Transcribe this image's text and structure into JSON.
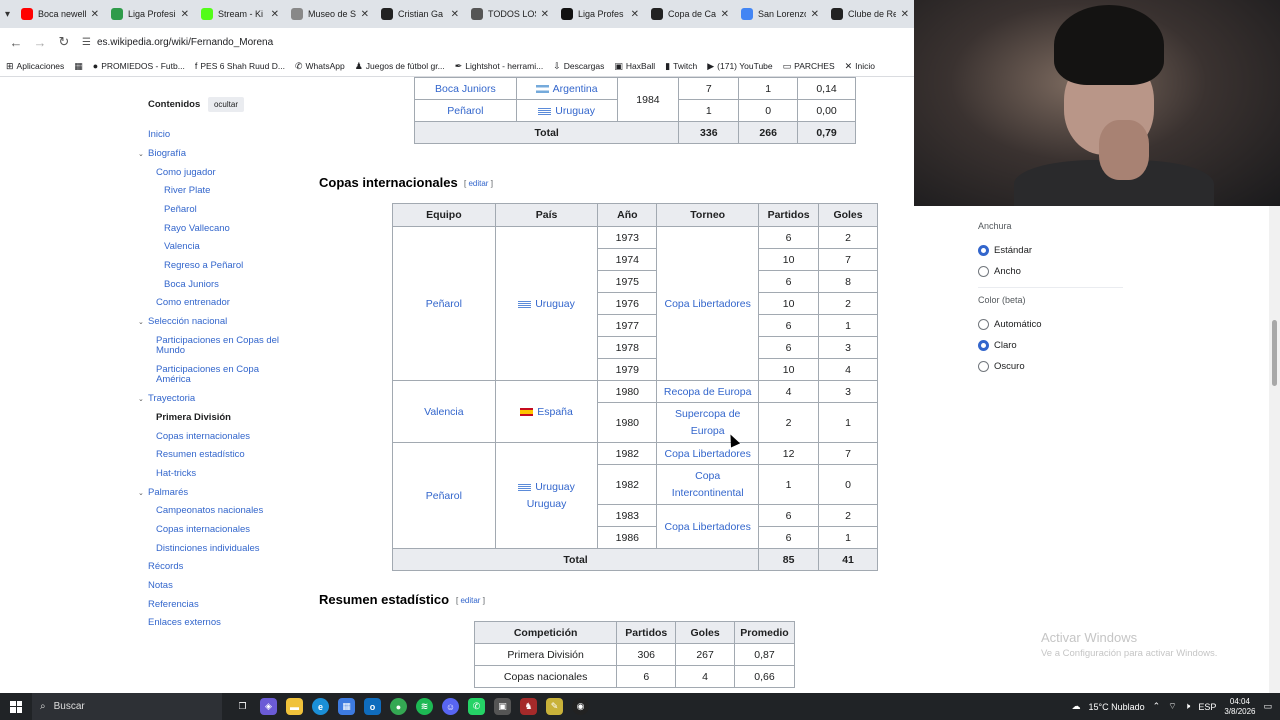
{
  "browser": {
    "tabs": [
      {
        "label": "Boca newell",
        "color": "#ff0000",
        "icon": "youtube-icon"
      },
      {
        "label": "Liga Profesi",
        "color": "#2e9b49",
        "icon": "league-icon"
      },
      {
        "label": "Stream - Ki",
        "color": "#53fc18",
        "icon": "kick-icon"
      },
      {
        "label": "Museo de S",
        "color": "#888888",
        "icon": "globe-icon"
      },
      {
        "label": "Cristian Ga",
        "color": "#222222",
        "icon": "wikipedia-icon"
      },
      {
        "label": "TODOS LOS",
        "color": "#555555",
        "icon": "globe-icon"
      },
      {
        "label": "Liga Profes",
        "color": "#111111",
        "icon": "league-icon"
      },
      {
        "label": "Copa de Ca",
        "color": "#222222",
        "icon": "wikipedia-icon"
      },
      {
        "label": "San Lorenzo",
        "color": "#4285f4",
        "icon": "google-icon"
      },
      {
        "label": "Clube de Re",
        "color": "#222222",
        "icon": "wikipedia-icon"
      }
    ],
    "url": "es.wikipedia.org/wiki/Fernando_Morena",
    "bookmarks": [
      {
        "label": "Aplicaciones",
        "icon": "apps-icon"
      },
      {
        "label": "",
        "icon": "grid-icon"
      },
      {
        "label": "PROMIEDOS - Futb...",
        "icon": "promiedos-icon"
      },
      {
        "label": "PES 6 Shah Ruud D...",
        "icon": "facebook-icon"
      },
      {
        "label": "WhatsApp",
        "icon": "whatsapp-icon"
      },
      {
        "label": "Juegos de fútbol gr...",
        "icon": "game-icon"
      },
      {
        "label": "Lightshot - herrami...",
        "icon": "lightshot-icon"
      },
      {
        "label": "Descargas",
        "icon": "download-icon"
      },
      {
        "label": "HaxBall",
        "icon": "haxball-icon"
      },
      {
        "label": "Twitch",
        "icon": "twitch-icon"
      },
      {
        "label": "(171) YouTube",
        "icon": "youtube-icon"
      },
      {
        "label": "PARCHES",
        "icon": "folder-icon"
      },
      {
        "label": "Inicio",
        "icon": "x-icon"
      }
    ]
  },
  "toc": {
    "title": "Contenidos",
    "hide": "ocultar",
    "items": [
      {
        "label": "Inicio"
      },
      {
        "label": "Biografía"
      },
      {
        "label": "Como jugador"
      },
      {
        "label": "River Plate"
      },
      {
        "label": "Peñarol"
      },
      {
        "label": "Rayo Vallecano"
      },
      {
        "label": "Valencia"
      },
      {
        "label": "Regreso a Peñarol"
      },
      {
        "label": "Boca Juniors"
      },
      {
        "label": "Como entrenador"
      },
      {
        "label": "Selección nacional"
      },
      {
        "label": "Participaciones en Copas del Mundo"
      },
      {
        "label": "Participaciones en Copa América"
      },
      {
        "label": "Trayectoria"
      },
      {
        "label": "Primera División"
      },
      {
        "label": "Copas internacionales"
      },
      {
        "label": "Resumen estadístico"
      },
      {
        "label": "Hat-tricks"
      },
      {
        "label": "Palmarés"
      },
      {
        "label": "Campeonatos nacionales"
      },
      {
        "label": "Copas internacionales"
      },
      {
        "label": "Distinciones individuales"
      },
      {
        "label": "Récords"
      },
      {
        "label": "Notas"
      },
      {
        "label": "Referencias"
      },
      {
        "label": "Enlaces externos"
      }
    ]
  },
  "top_table": {
    "rows": [
      {
        "team": "Boca Juniors",
        "country": "Argentina",
        "year": "1984",
        "p": "7",
        "g": "1",
        "avg": "0,14"
      },
      {
        "team": "Peñarol",
        "country": "Uruguay",
        "p": "1",
        "g": "0",
        "avg": "0,00"
      }
    ],
    "total_label": "Total",
    "total_p": "336",
    "total_g": "266",
    "total_avg": "0,79"
  },
  "intl": {
    "heading": "Copas internacionales",
    "edit": "editar",
    "headers": [
      "Equipo",
      "País",
      "Año",
      "Torneo",
      "Partidos",
      "Goles"
    ],
    "g1": {
      "team": "Peñarol",
      "country": "Uruguay",
      "tournament": "Copa Libertadores",
      "rows": [
        {
          "year": "1973",
          "p": "6",
          "g": "2"
        },
        {
          "year": "1974",
          "p": "10",
          "g": "7"
        },
        {
          "year": "1975",
          "p": "6",
          "g": "8"
        },
        {
          "year": "1976",
          "p": "10",
          "g": "2"
        },
        {
          "year": "1977",
          "p": "6",
          "g": "1"
        },
        {
          "year": "1978",
          "p": "6",
          "g": "3"
        },
        {
          "year": "1979",
          "p": "10",
          "g": "4"
        }
      ]
    },
    "g2": {
      "team": "Valencia",
      "country": "España",
      "rows": [
        {
          "year": "1980",
          "tournament": "Recopa de Europa",
          "p": "4",
          "g": "3"
        },
        {
          "year": "1980",
          "tournament": "Supercopa de Europa",
          "p": "2",
          "g": "1"
        }
      ]
    },
    "g3": {
      "team": "Peñarol",
      "country": "Uruguay",
      "country2": "Uruguay",
      "rows": [
        {
          "year": "1982",
          "tournament": "Copa Libertadores",
          "p": "12",
          "g": "7"
        },
        {
          "year": "1982",
          "tournament": "Copa Intercontinental",
          "p": "1",
          "g": "0"
        },
        {
          "year": "1983",
          "p": "6",
          "g": "2"
        },
        {
          "year": "1986",
          "p": "6",
          "g": "1"
        }
      ],
      "tournament_merged": "Copa Libertadores"
    },
    "total_label": "Total",
    "total_p": "85",
    "total_g": "41"
  },
  "summary": {
    "heading": "Resumen estadístico",
    "edit": "editar",
    "headers": [
      "Competición",
      "Partidos",
      "Goles",
      "Promedio"
    ],
    "rows": [
      {
        "comp": "Primera División",
        "p": "306",
        "g": "267",
        "avg": "0,87"
      },
      {
        "comp": "Copas nacionales",
        "p": "6",
        "g": "4",
        "avg": "0,66"
      }
    ]
  },
  "appearance": {
    "width_label": "Anchura",
    "width_options": [
      "Estándar",
      "Ancho"
    ],
    "color_label": "Color (beta)",
    "color_options": [
      "Automático",
      "Claro",
      "Oscuro"
    ]
  },
  "watermark": {
    "line1": "Activar Windows",
    "line2": "Ve a Configuración para activar Windows."
  },
  "taskbar": {
    "search": "Buscar",
    "weather": "15°C  Nublado",
    "lang": "ESP",
    "time": "04:04",
    "date": "3/8/2026"
  }
}
